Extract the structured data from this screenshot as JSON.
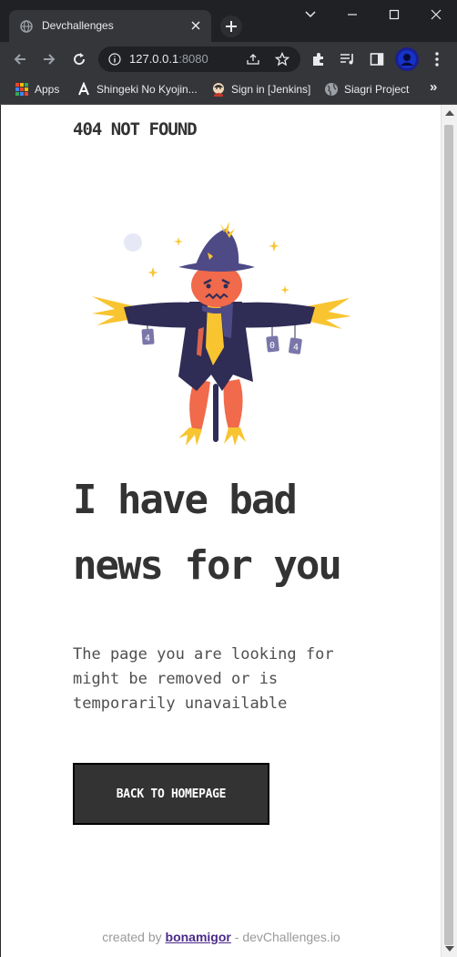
{
  "browser": {
    "tab_title": "Devchallenges",
    "url_host": "127.0.0.1",
    "url_port": ":8080",
    "bookmarks": [
      {
        "label": "Apps",
        "icon": "apps-grid-icon"
      },
      {
        "label": "Shingeki No Kyojin...",
        "icon": "letter-a-icon"
      },
      {
        "label": "Sign in [Jenkins]",
        "icon": "jenkins-icon"
      },
      {
        "label": "Siagri Project",
        "icon": "globe-icon"
      }
    ],
    "bookmarks_overflow": "»"
  },
  "page": {
    "brand": "404 NOT FOUND",
    "illustration_tags": [
      "4",
      "0",
      "4"
    ],
    "headline": "I have bad news for you",
    "description": "The page you are looking for might be removed or is temporarily unavailable",
    "button_label": "BACK TO HOMEPAGE",
    "footer": {
      "prefix": "created by ",
      "author": "bonamigor",
      "suffix": " - devChallenges.io"
    }
  },
  "colors": {
    "text_dark": "#333333",
    "text_body": "#4f4f4f",
    "footer_link": "#4b2a8a",
    "scarecrow_coat": "#2f2c56",
    "scarecrow_hat": "#4e4a86",
    "scarecrow_face": "#f06a4b",
    "straw": "#f8c531"
  }
}
